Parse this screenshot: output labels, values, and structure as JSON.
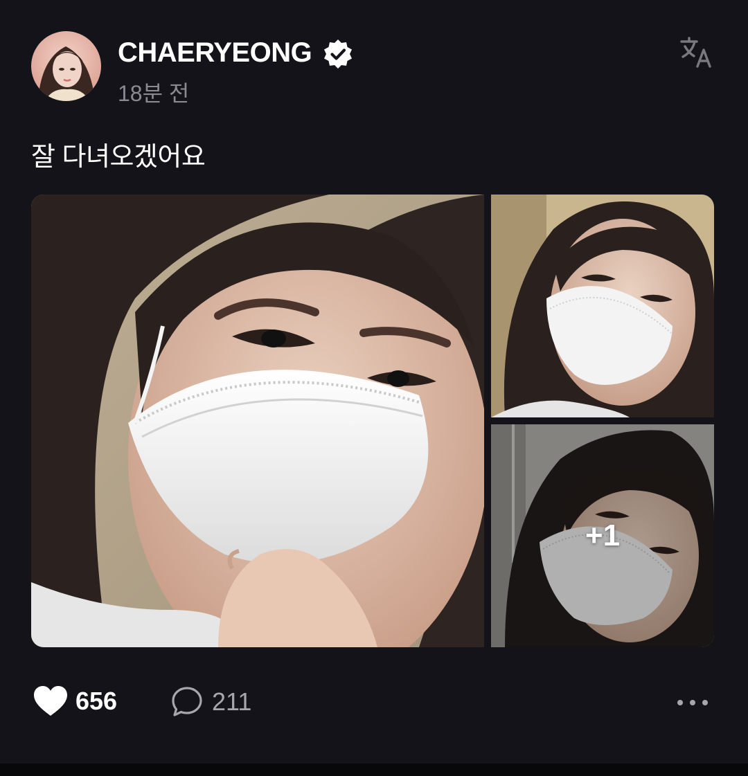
{
  "author": {
    "name": "CHAERYEONG",
    "verified": true,
    "timestamp": "18분 전",
    "avatar_alt": "avatar"
  },
  "post": {
    "text": "잘 다녀오겠어요",
    "photos": [
      "main-selfie",
      "selfie-2",
      "selfie-3"
    ],
    "more_photos_label": "+1"
  },
  "actions": {
    "like_count": "656",
    "comment_count": "211"
  },
  "icons": {
    "verified": "verified-badge-icon",
    "translate": "translate-icon",
    "like": "heart-icon",
    "comment": "comment-bubble-icon",
    "more": "more-dots-icon"
  },
  "colors": {
    "background": "#141319",
    "text_primary": "#ffffff",
    "text_secondary": "#8b8a92",
    "icon_gray": "#a7a6ad"
  }
}
